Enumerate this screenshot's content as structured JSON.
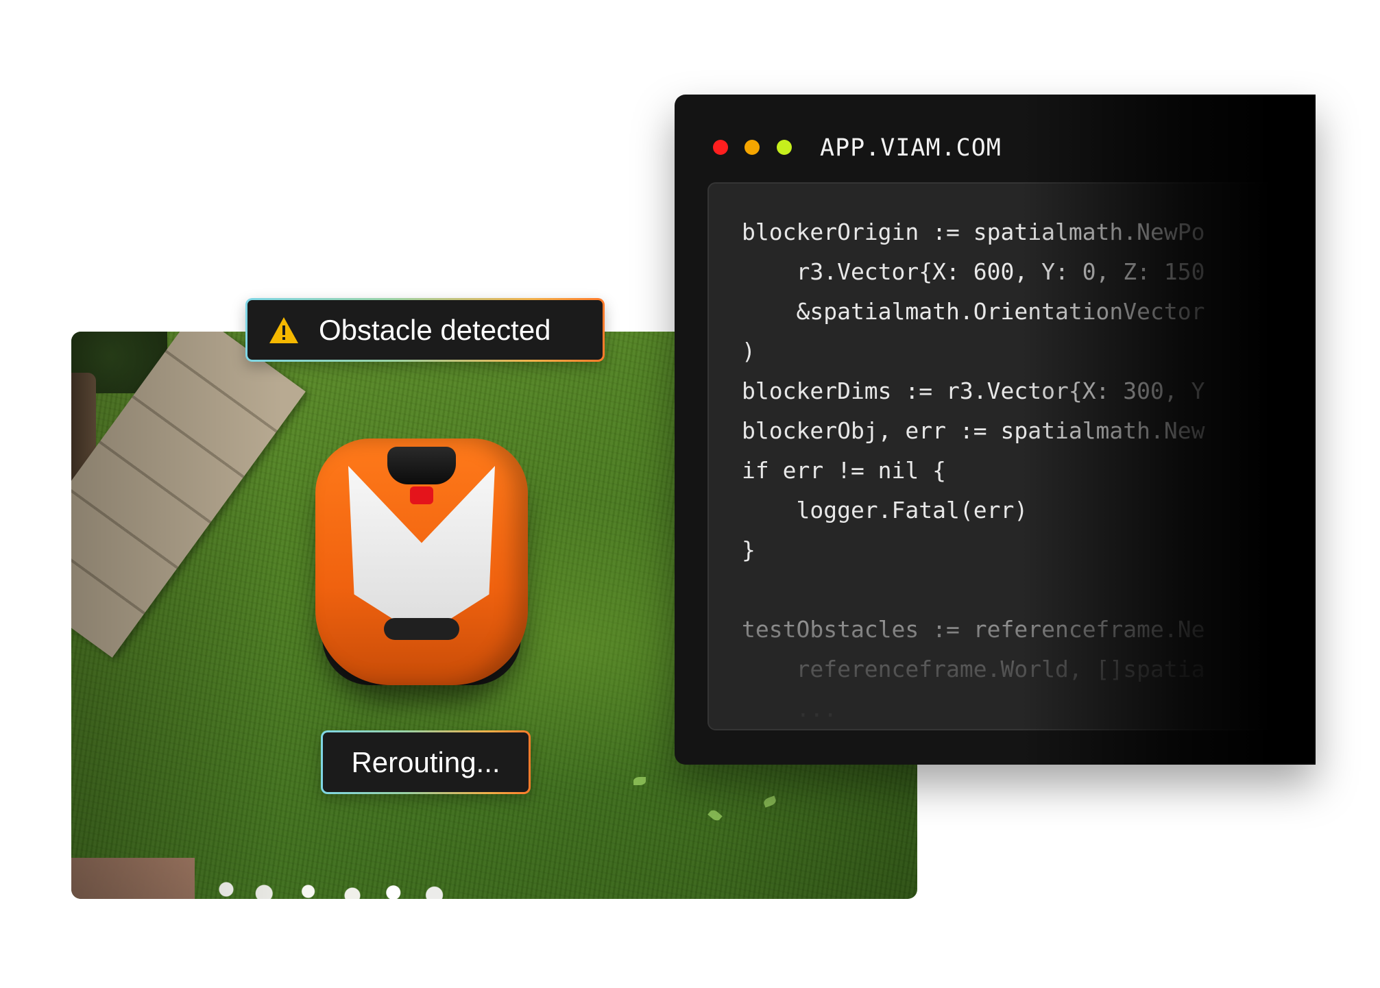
{
  "photo": {
    "alt": "Robotic lawn mower on grass"
  },
  "status": {
    "obstacle_label": "Obstacle detected",
    "reroute_label": "Rerouting..."
  },
  "window": {
    "url": "APP.VIAM.COM",
    "controls": [
      "close",
      "minimize",
      "maximize"
    ]
  },
  "code": {
    "lines": [
      "blockerOrigin := spatialmath.NewPo",
      "    r3.Vector{X: 600, Y: 0, Z: 150",
      "    &spatialmath.OrientationVector",
      ")",
      "blockerDims := r3.Vector{X: 300, Y",
      "blockerObj, err := spatialmath.New",
      "if err != nil {",
      "    logger.Fatal(err)",
      "}",
      "",
      "testObstacles := referenceframe.Ne",
      "    referenceframe.World, []spatia",
      "    ..."
    ]
  },
  "colors": {
    "dot_red": "#ff1f1f",
    "dot_yellow": "#f5a500",
    "dot_green": "#c6ef1d",
    "mower_orange": "#f0620f",
    "warning_yellow": "#f5b800"
  },
  "icons": {
    "warning": "warning-triangle-icon"
  }
}
